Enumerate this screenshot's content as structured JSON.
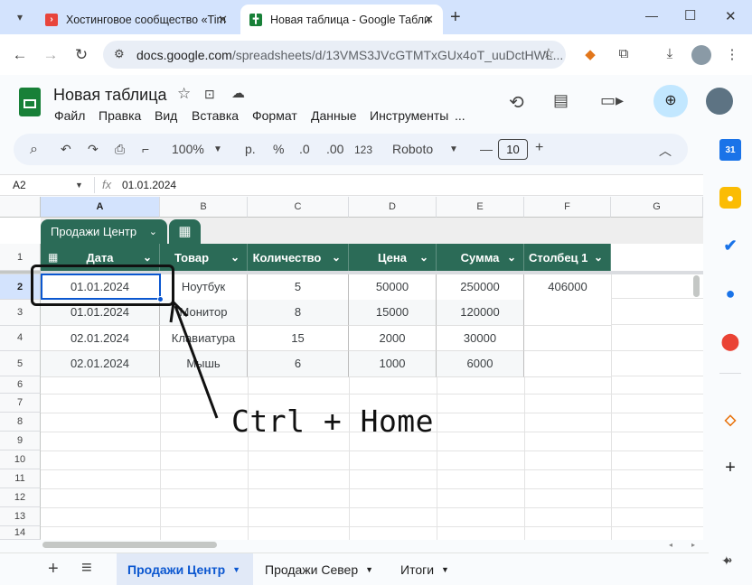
{
  "browser": {
    "tabs": [
      {
        "title": "Хостинговое сообщество «Tim",
        "favicon_color": "#e8453c"
      },
      {
        "title": "Новая таблица - Google Табли",
        "favicon_color": "#188038"
      }
    ],
    "new_tab": "+",
    "url_host": "docs.google.com",
    "url_path": "/spreadsheets/d/13VMS3JVcGTMTxGUx4oT_uuDctHWL...",
    "window_controls": {
      "minimize": "—",
      "maximize": "☐",
      "close": "✕"
    }
  },
  "doc": {
    "title": "Новая таблица",
    "menu": [
      "Файл",
      "Правка",
      "Вид",
      "Вставка",
      "Формат",
      "Данные",
      "Инструменты",
      "..."
    ]
  },
  "toolbar": {
    "zoom": "100%",
    "currency": "р.",
    "percent": "%",
    "dec_dec": ".0",
    "inc_dec": ".00",
    "num_format": "123",
    "font": "Roboto",
    "font_size": "10"
  },
  "formula_bar": {
    "cell_ref": "A2",
    "fx": "fx",
    "value": "01.01.2024"
  },
  "table": {
    "name": "Продажи Центр",
    "columns": [
      "A",
      "B",
      "C",
      "D",
      "E",
      "F",
      "G"
    ],
    "rows": [
      "1",
      "2",
      "3",
      "4",
      "5",
      "6",
      "7",
      "8",
      "9",
      "10",
      "11",
      "12",
      "13",
      "14"
    ],
    "headers": [
      "Дата",
      "Товар",
      "Количество",
      "Цена",
      "Сумма",
      "Столбец 1"
    ],
    "data": [
      [
        "01.01.2024",
        "Ноутбук",
        "5",
        "50000",
        "250000",
        "406000"
      ],
      [
        "01.01.2024",
        "Монитор",
        "8",
        "15000",
        "120000",
        ""
      ],
      [
        "02.01.2024",
        "Клавиатура",
        "15",
        "2000",
        "30000",
        ""
      ],
      [
        "02.01.2024",
        "Мышь",
        "6",
        "1000",
        "6000",
        ""
      ]
    ]
  },
  "annotation": "Ctrl + Home",
  "sheets": {
    "add": "+",
    "list_icon": "≡",
    "tabs": [
      "Продажи Центр",
      "Продажи Север",
      "Итоги"
    ],
    "active": "Продажи Центр"
  },
  "colors": {
    "accent": "#0b57d0",
    "table_header": "#2b6b57",
    "active_tab_bg": "#e1e9f7"
  }
}
